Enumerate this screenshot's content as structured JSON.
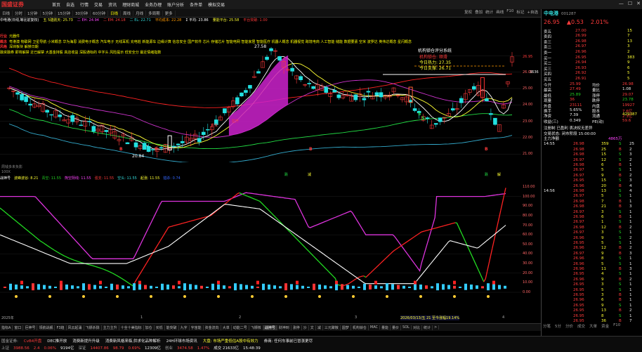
{
  "app": {
    "logo": "国盛证券"
  },
  "menu": {
    "items": [
      "首页",
      "自选",
      "行情",
      "交易",
      "资讯",
      "理财商城",
      "业务办理",
      "账户分析",
      "条件单",
      "模拟交易"
    ]
  },
  "toolbar": {
    "items": [
      "日线",
      "分时",
      "1分钟",
      "5分钟",
      "15分钟",
      "30分钟",
      "60分钟",
      "日线",
      "周线",
      "月线",
      "多周期",
      "更多"
    ],
    "active_index": 7,
    "right": [
      "复权",
      "叠加",
      "统计",
      "画线",
      "F10",
      "标记",
      "+自选"
    ]
  },
  "infoline": {
    "items": [
      {
        "text": "中电港(日线,等比前复权)",
        "color": "#ffffff"
      },
      {
        "text": "五 5建航天: 25.73",
        "color": "#ffff33"
      },
      {
        "text": "二 EH: 24.94",
        "color": "#ff44ff"
      },
      {
        "text": "二 EM: 24.18",
        "color": "#ff3b3b"
      },
      {
        "text": "二 EL: 22.71",
        "color": "#33dddd"
      },
      {
        "text": "平均成本: 22.28",
        "color": "#ff9900"
      },
      {
        "text": "Σ 平均: 23.86",
        "color": "#ffffff"
      },
      {
        "text": "量能平台: 25.58",
        "color": "#ffff33"
      },
      {
        "text": "平台突破: 1.00",
        "color": "#ff3b3b"
      }
    ]
  },
  "concepts": [
    {
      "tag": "行业",
      "text": "元器件"
    },
    {
      "tag": "概念",
      "text": "粤港澳 物联网 卫星导航 小米概念 华为海思 消费电子概念 汽车电子 无线耳机 充电桩 新能源车 边缘计算 信息安全 国产软件 芯片 存储芯片 智能电网 智能家居 智能医疗 机器人概念 机器视觉 跨境电商 人工智能 储能 数据要素 空米 波罗达 英伟达概念 星闪概念"
    },
    {
      "tag": "风格",
      "text": "深圳板块            解禁日期"
    },
    {
      "tag": "",
      "text": "融资融券 即将解禁 近已解禁 大基金持股 高店收益 深股通标的 中字头 风险提示 低安全分 最近情绪指数"
    }
  ],
  "chart_overlay": {
    "high_label": "27.58",
    "low_label": "20.84",
    "box_title": "机构锁仓评分系统",
    "box_lines": [
      "机构锁仓: 顺滑",
      "今日热力: 27.35",
      "今日支撑: 26.71"
    ],
    "watermark": "周钱多未负影",
    "wave_marks": [
      "拉升",
      "进攻"
    ],
    "buy_marks": [
      "B",
      "B",
      "B",
      "B"
    ],
    "sell_marks": [
      "S",
      "S"
    ],
    "bottom_marks": [
      "跌",
      "减",
      "跌",
      "解"
    ]
  },
  "price_axis": [
    "26.95",
    "26.00",
    "25.00",
    "24.00",
    "23.00",
    "22.00",
    "21.00"
  ],
  "price_axis_extra": "3636",
  "sub_header": {
    "items": [
      {
        "text": "战神号",
        "color": "#ffffff"
      },
      {
        "text": "波峰波谷: 8.21",
        "color": "#ffff33"
      },
      {
        "text": "青空: 11.55",
        "color": "#22d022"
      },
      {
        "text": "熊空阴线: 11.55",
        "color": "#ff44ff"
      },
      {
        "text": "强支: 11.55",
        "color": "#ff3b3b"
      },
      {
        "text": "空头: 11.55",
        "color": "#33dddd"
      },
      {
        "text": "起涨: 11.55",
        "color": "#ffff33"
      },
      {
        "text": "猎杀: 0.74",
        "color": "#3366ff"
      }
    ]
  },
  "sub_axis": [
    "110.00",
    "100.00",
    "90.00",
    "80.00",
    "70.00",
    "60.00",
    "50.00",
    "40.00",
    "30.00",
    "20.00",
    "10.00",
    "0.00"
  ],
  "date_row": {
    "left": "2025年",
    "mid1": "1",
    "mid2": "2",
    "mid3": "3",
    "info": "2026/03/13/五 21 至今涨幅19.14%",
    "right": "4"
  },
  "bottom_tabs": {
    "items": [
      "指标A",
      "窗口",
      "巨神号",
      "领航战舰",
      "F3趋",
      "风云起涌",
      "飞镖杀戮",
      "主力主升",
      "十全十美指标",
      "加仓",
      "买低",
      "能突破",
      "九字",
      "宇宙能",
      "资金流向",
      "大单",
      "动能二号",
      "飞镖核",
      "战神号",
      "财神到",
      "涨停",
      "沙",
      "文",
      "减",
      "三元聚散",
      "圆梦",
      "机构锁仓",
      "MAC",
      "量能",
      "量价",
      "SOL",
      "对比",
      "统计",
      ">"
    ],
    "active": "战神号"
  },
  "status": {
    "line1": [
      {
        "text": "国金证券:",
        "color": "#aaaaaa"
      },
      {
        "text": "CvB4开盘",
        "color": "#ff3b3b"
      },
      {
        "text": "DEC推开放",
        "color": "#eeeeee"
      },
      {
        "text": "消费新提升升级",
        "color": "#eeeeee"
      },
      {
        "text": "消费新风格来临,供求化品种解析",
        "color": "#eeeeee"
      },
      {
        "text": "24H环球市场资讯",
        "color": "#eeeeee"
      },
      {
        "text": "大盘: 市场严重低估A股中有效力",
        "color": "#ffff33"
      },
      {
        "text": "券商: 任何车事前已冒涨更尽",
        "color": "#eeeeee"
      }
    ],
    "line2": [
      {
        "text": "上证",
        "color": "#aaaaaa"
      },
      {
        "text": "3988.56",
        "color": "#ff3b3b"
      },
      {
        "text": "2.4",
        "color": "#ff3b3b"
      },
      {
        "text": "0.06%",
        "color": "#ff3b3b"
      },
      {
        "text": "9194亿",
        "color": "#eeeeee"
      },
      {
        "text": "深证",
        "color": "#aaaaaa"
      },
      {
        "text": "14407.86",
        "color": "#ff3b3b"
      },
      {
        "text": "98.79",
        "color": "#ff3b3b"
      },
      {
        "text": "0.69%",
        "color": "#ff3b3b"
      },
      {
        "text": "12309亿",
        "color": "#eeeeee"
      },
      {
        "text": "创业",
        "color": "#aaaaaa"
      },
      {
        "text": "3474.58",
        "color": "#ff3b3b"
      },
      {
        "text": "1.47%",
        "color": "#ff3b3b"
      },
      {
        "text": "成交 21633亿",
        "color": "#eeeeee"
      },
      {
        "text": "15:48:39",
        "color": "#eeeeee"
      }
    ]
  },
  "quote": {
    "name": "中电港",
    "code": "001287",
    "price": "26.95",
    "change": "▲0.53",
    "pct": "2.01%",
    "asks": [
      [
        "卖五",
        "27.00",
        "15"
      ],
      [
        "卖四",
        "26.99",
        "7"
      ],
      [
        "卖三",
        "26.98",
        "13"
      ],
      [
        "卖二",
        "26.97",
        "3"
      ],
      [
        "卖一",
        "26.96",
        "2"
      ]
    ],
    "bids": [
      [
        "买一",
        "26.95",
        "383"
      ],
      [
        "买二",
        "26.94",
        "9"
      ],
      [
        "买三",
        "26.93",
        "6"
      ],
      [
        "买四",
        "26.92",
        "5"
      ],
      [
        "买五",
        "26.91",
        "5"
      ]
    ],
    "stats": [
      [
        "今开",
        "25.99",
        "均价",
        "26.98"
      ],
      [
        "最高",
        "27.49",
        "量比",
        "1.08"
      ],
      [
        "最低",
        "25.89",
        "涨停",
        "29.07"
      ],
      [
        "现量",
        "36",
        "跌停",
        "23.78"
      ],
      [
        "外盘",
        "23111",
        "内盘",
        "19927"
      ],
      [
        "换手",
        "5.65%",
        "股本",
        "7.6亿"
      ],
      [
        "净资",
        "7.39",
        "流通",
        "2.3亿"
      ],
      [
        "收益(三)",
        "0.349",
        "PE(动)",
        "59.6"
      ]
    ],
    "total_vol": "429387",
    "notice": "注册制 已盈利 表决权无差异",
    "trade_status": "交易状态: 闭市阶段 15:00:00",
    "net_label": "主力净额",
    "net_value": "4865万",
    "ticks": [
      [
        "14:55",
        "26.98",
        "359",
        "S",
        "25"
      ],
      [
        "",
        "26.98",
        "25",
        "B",
        "2"
      ],
      [
        "",
        "26.98",
        "15",
        "S",
        "3"
      ],
      [
        "",
        "26.97",
        "12",
        "S",
        "2"
      ],
      [
        "",
        "26.98",
        "6",
        "B",
        "1"
      ],
      [
        "",
        "26.97",
        "5",
        "S",
        "1"
      ],
      [
        "",
        "26.97",
        "9",
        "B",
        "2"
      ],
      [
        "",
        "26.95",
        "15",
        "S",
        "3"
      ],
      [
        "",
        "26.96",
        "20",
        "B",
        "4"
      ],
      [
        "14:56",
        "26.98",
        "13",
        "S",
        "4"
      ],
      [
        "",
        "26.97",
        "5",
        "S",
        "1"
      ],
      [
        "",
        "26.98",
        "7",
        "B",
        "1"
      ],
      [
        "",
        "26.98",
        "21",
        "B",
        "3"
      ],
      [
        "",
        "26.97",
        "3",
        "S",
        "1"
      ],
      [
        "",
        "26.98",
        "6",
        "B",
        "1"
      ],
      [
        "",
        "26.97",
        "1",
        "S",
        "1"
      ],
      [
        "",
        "26.98",
        "12",
        "B",
        "2"
      ],
      [
        "",
        "26.97",
        "3",
        "S",
        "1"
      ],
      [
        "",
        "26.96",
        "9",
        "S",
        "2"
      ],
      [
        "",
        "26.95",
        "5",
        "S",
        "1"
      ],
      [
        "",
        "26.96",
        "12",
        "B",
        "2"
      ],
      [
        "",
        "26.97",
        "9",
        "B",
        "3"
      ],
      [
        "",
        "26.96",
        "8",
        "S",
        "1"
      ],
      [
        "",
        "26.96",
        "5",
        "S",
        "1"
      ],
      [
        "",
        "26.96",
        "11",
        "B",
        "3"
      ],
      [
        "",
        "26.95",
        "4",
        "S",
        "1"
      ],
      [
        "",
        "26.96",
        "9",
        "B",
        "2"
      ],
      [
        "",
        "26.95",
        "3",
        "S",
        "1"
      ],
      [
        "",
        "26.95",
        "5",
        "S",
        "1"
      ],
      [
        "",
        "26.95",
        "3",
        "B",
        "1"
      ],
      [
        "",
        "26.96",
        "6",
        "B",
        "1"
      ],
      [
        "",
        "26.95",
        "9",
        "S",
        "1"
      ],
      [
        "",
        "26.95",
        "13",
        "B",
        "2"
      ],
      [
        "",
        "26.95",
        "8",
        "S",
        "1"
      ],
      [
        "",
        "26.95",
        "36",
        "B",
        "7"
      ]
    ],
    "tabs": [
      "分笔",
      "5分",
      "分价",
      "成交",
      "大单",
      "资金",
      "F10"
    ]
  }
}
